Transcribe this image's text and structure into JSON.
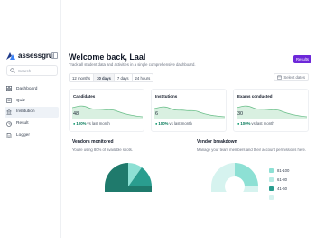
{
  "sidebar": {
    "brand": "assessgru",
    "search_placeholder": "Search",
    "items": [
      {
        "label": "Dashboard",
        "icon": "grid-icon",
        "active": false
      },
      {
        "label": "Quiz",
        "icon": "quiz-icon",
        "active": false
      },
      {
        "label": "Institution",
        "icon": "building-icon",
        "active": true
      },
      {
        "label": "Result",
        "icon": "chart-icon",
        "active": false
      },
      {
        "label": "Logger",
        "icon": "document-icon",
        "active": false
      }
    ]
  },
  "header": {
    "title": "Welcome back, Laal",
    "subtitle": "Track all student data and activities in a single comprehensive dashboard.",
    "results_button": "Results"
  },
  "filters": {
    "ranges": [
      "12 months",
      "30 days",
      "7 days",
      "24 hours"
    ],
    "active_range": "30 days",
    "select_dates": "Select dates"
  },
  "stats": [
    {
      "label": "Candidates",
      "value": "48",
      "change": "100%",
      "change_text": "vs last month"
    },
    {
      "label": "Institutions",
      "value": "6",
      "change": "100%",
      "change_text": "vs last month"
    },
    {
      "label": "Exams conducted",
      "value": "30",
      "change": "100%",
      "change_text": "vs last month"
    }
  ],
  "vendors_monitored": {
    "title": "Vendors monitored",
    "subtitle": "You're using 80% of available spots."
  },
  "vendor_breakdown": {
    "title": "Vendor breakdown",
    "subtitle": "Manage your team members and their account permissions here.",
    "legend": [
      {
        "label": "81-100",
        "color": "#8de0d4"
      },
      {
        "label": "61-80",
        "color": "#b7ece5"
      },
      {
        "label": "41-60",
        "color": "#2a9d8f"
      },
      {
        "label": "",
        "color": "#d6f3ef"
      }
    ]
  },
  "colors": {
    "accent": "#6d28d9",
    "spark_line": "#6bbf8a",
    "spark_fill": "#d9f0e1",
    "positive": "#047857",
    "pie_dark": "#1f7a6c",
    "pie_mid": "#2a9d8f",
    "pie_light": "#8de0d4"
  }
}
